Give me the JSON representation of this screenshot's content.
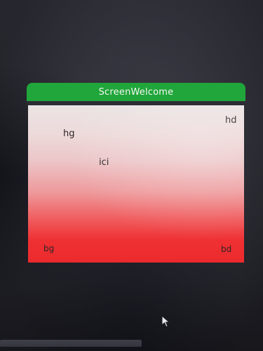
{
  "window": {
    "title": "ScreenWelcome"
  },
  "labels": {
    "top_left": "hg",
    "top_right": "hd",
    "center": "ici",
    "bottom_left": "bg",
    "bottom_right": "bd"
  },
  "icons": {
    "cursor": "mouse-pointer-icon"
  },
  "colors": {
    "titlebar": "#20a63a",
    "title_text": "#f3f7f2",
    "gradient_top": "#ebe4e4",
    "gradient_bottom": "#ec2a2d",
    "label_text": "#2c2526",
    "background": "#35353f"
  }
}
